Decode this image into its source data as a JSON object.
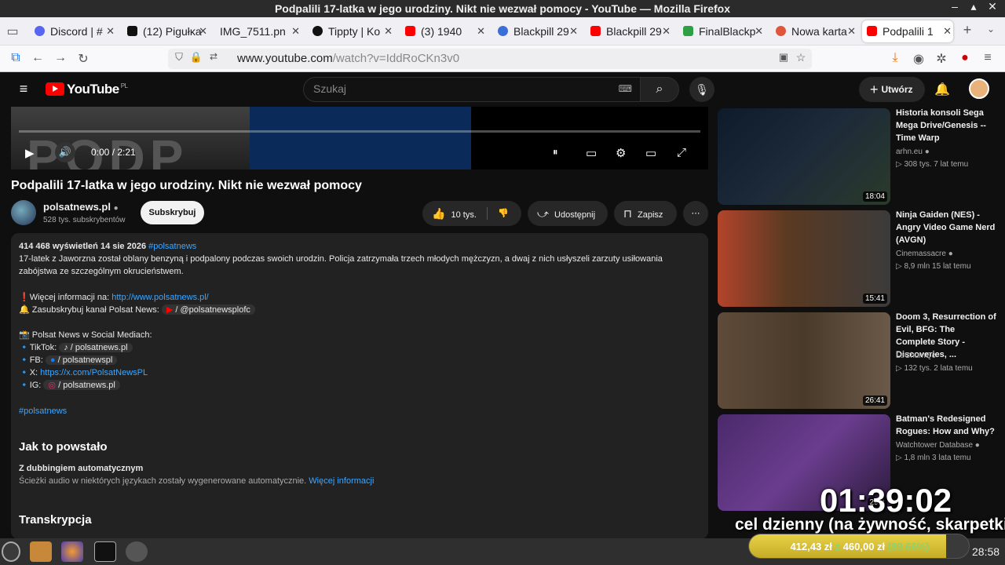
{
  "window": {
    "title": "Podpalili 17-latka w jego urodziny. Nikt nie wezwał pomocy - YouTube — Mozilla Firefox"
  },
  "tabs": [
    {
      "label": "Discord | #",
      "color": "#5865f2"
    },
    {
      "label": "(12) Pigułĸa",
      "color": "#111111"
    },
    {
      "label": "IMG_7511.pn",
      "color": "#cccccc"
    },
    {
      "label": "Tippty | Ko",
      "color": "#111111"
    },
    {
      "label": "(3) 1940",
      "color": "#ff0000"
    },
    {
      "label": "Blackpill 29",
      "color": "#3b6fd8"
    },
    {
      "label": "Blackpill 29",
      "color": "#ff0000"
    },
    {
      "label": "FinalBlackp",
      "color": "#2ea043"
    },
    {
      "label": "Nowa karta",
      "color": "#e0563a"
    },
    {
      "label": "Podpalili 1",
      "color": "#ff0000"
    }
  ],
  "nav": {
    "url_host": "www.youtube.com",
    "url_path": "/watch?v=IddRoCKn3v0"
  },
  "yt": {
    "logo": "YouTube",
    "region": "PL",
    "search_placeholder": "Szukaj",
    "create_label": "Utwórz",
    "player": {
      "time": "0:00 / 2:21"
    },
    "video_title": "Podpalili 17-latka w jego urodziny. Nikt nie wezwał pomocy",
    "channel": {
      "name": "polsatnews.pl",
      "subs": "528 tys. subskrybentów",
      "subscribe": "Subskrybuj"
    },
    "actions": {
      "likes": "10 tys.",
      "share": "Udostępnij",
      "save": "Zapisz"
    },
    "description": {
      "meta": "414 468 wyświetleń  14 sie 2026",
      "meta_tag": "#polsatnews",
      "line1": "17-latek z Jaworzna został oblany benzyną i podpalony podczas swoich urodzin. Policja zatrzymała trzech młodych mężczyzn, a dwaj z nich usłyszeli zarzuty usiłowania",
      "line2": "zabójstwa ze szczególnym okrucieństwem.",
      "more_info": "❗Więcej informacji na: ",
      "more_info_link": "http://www.polsatnews.pl/",
      "subscribe_line": "🔔 Zasubskrybuj kanał Polsat News: ",
      "subscribe_chip": "/ @polsatnewsplofc",
      "social_heading": "📸 Polsat News w Social Mediach:",
      "tiktok_label": "🔹TikTok: ",
      "tiktok_chip": "/ polsatnews.pl",
      "fb_label": "🔹FB: ",
      "fb_chip": "/ polsatnewspl",
      "x_label": "🔹X: ",
      "x_link": "https://x.com/PolsatNewsPL",
      "ig_label": "🔹IG: ",
      "ig_chip": "/ polsatnews.pl",
      "hashtag": "#polsatnews",
      "how_made": "Jak to powstało",
      "dub_title": "Z dubbingiem automatycznym",
      "dub_text": "Ścieżki audio w niektórych językach zostały wygenerowane automatycznie. ",
      "dub_link": "Więcej informacji",
      "transcript": "Transkrypcja"
    },
    "related": [
      {
        "title": "Historia konsoli Sega Mega Drive/Genesis -- Time Warp",
        "channel": "arhn.eu",
        "meta": "▷ 308 tys.   7 lat temu",
        "duration": "18:04",
        "thumb": "#1d2a3a"
      },
      {
        "title": "Ninja Gaiden (NES) - Angry Video Game Nerd (AVGN)",
        "channel": "Cinemassacre",
        "meta": "▷ 8,9 mln   15 lat temu",
        "duration": "15:41",
        "thumb": "#5a3a22"
      },
      {
        "title": "Doom 3, Resurrection of Evil, BFG: The Complete Story - Discoveries, ...",
        "channel": "LeChumQc",
        "meta": "▷ 132 tys.   2 lata temu",
        "duration": "26:41",
        "thumb": "#4a3a2a"
      },
      {
        "title": "Batman's Redesigned Rogues: How and Why?",
        "channel": "Watchtower Database",
        "meta": "▷ 1,8 mln   3 lata temu",
        "duration": "29:4",
        "thumb": "#6b3d8f"
      }
    ]
  },
  "overlay": {
    "timer": "01:39:02",
    "caption": "cel dzienny (na żywność, skarpetki itp)",
    "goal_current": "412,43 zł",
    "goal_sep": " z ",
    "goal_target": "460,00 zł",
    "goal_pct": "(89.66%)",
    "goal_fraction": 0.8966
  },
  "taskbar": {
    "clock": "28:58"
  }
}
